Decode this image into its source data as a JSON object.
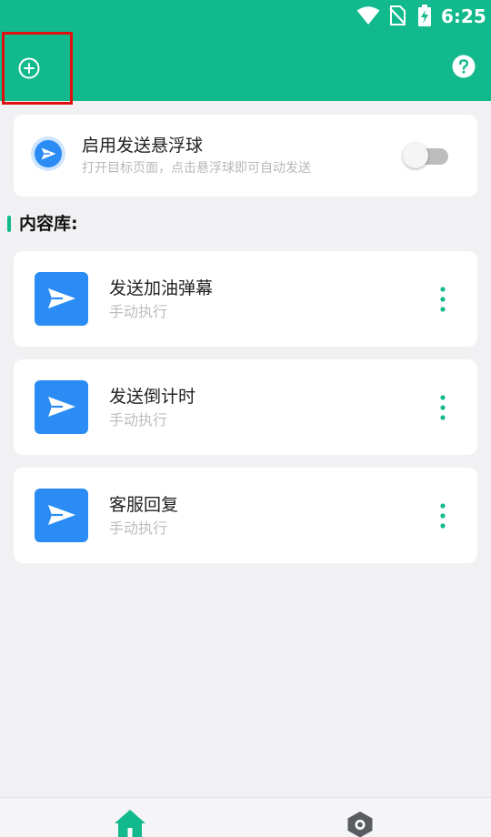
{
  "status_bar": {
    "time": "6:25"
  },
  "header": {
    "add_icon": "add-circle-icon",
    "help_icon": "help-icon",
    "accent_color": "#12b98c"
  },
  "float_ball": {
    "title": "启用发送悬浮球",
    "subtitle": "打开目标页面，点击悬浮球即可自动发送",
    "enabled": false
  },
  "library": {
    "title": "内容库:",
    "items": [
      {
        "title": "发送加油弹幕",
        "subtitle": "手动执行"
      },
      {
        "title": "发送倒计时",
        "subtitle": "手动执行"
      },
      {
        "title": "客服回复",
        "subtitle": "手动执行"
      }
    ]
  },
  "bottom_nav": {
    "items": [
      "home-icon",
      "settings-icon"
    ]
  }
}
